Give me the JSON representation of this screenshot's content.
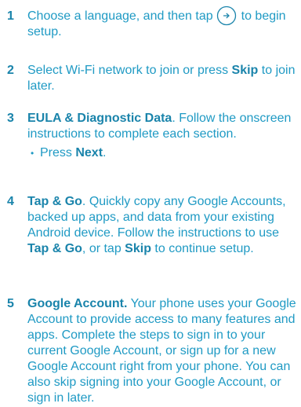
{
  "colors": {
    "text": "#1f9ac4",
    "emphasis": "#1a84ab",
    "background": "#ffffff"
  },
  "steps": [
    {
      "number": "1",
      "text_before_icon": "Choose a language, and then tap",
      "icon": "arrow-right-circle-icon",
      "text_after_icon": "to begin setup."
    },
    {
      "number": "2",
      "text_before": "Select Wi-Fi network to join or press ",
      "bold": "Skip",
      "text_after": " to join later."
    },
    {
      "number": "3",
      "bold": "EULA & Diagnostic Data",
      "text_after": ". Follow the onscreen instructions to complete each section.",
      "bullet": {
        "dot": "•",
        "text_before": "Press ",
        "bold": "Next",
        "text_after": "."
      }
    },
    {
      "number": "4",
      "bold": "Tap & Go",
      "text_1": ". Quickly copy any Google Accounts, backed up apps, and data from your existing Android device. Follow the instructions to use ",
      "bold_2": "Tap & Go",
      "text_2": ", or tap ",
      "bold_3": "Skip",
      "text_3": " to continue setup."
    },
    {
      "number": "5",
      "bold": "Google Account.",
      "text_after": " Your phone uses your Google Account to provide access to many features and apps. Complete the steps to sign in to your current Google Account, or sign up for a new Google Account right from your phone. You can also skip signing into your Google Account, or sign in later."
    }
  ]
}
